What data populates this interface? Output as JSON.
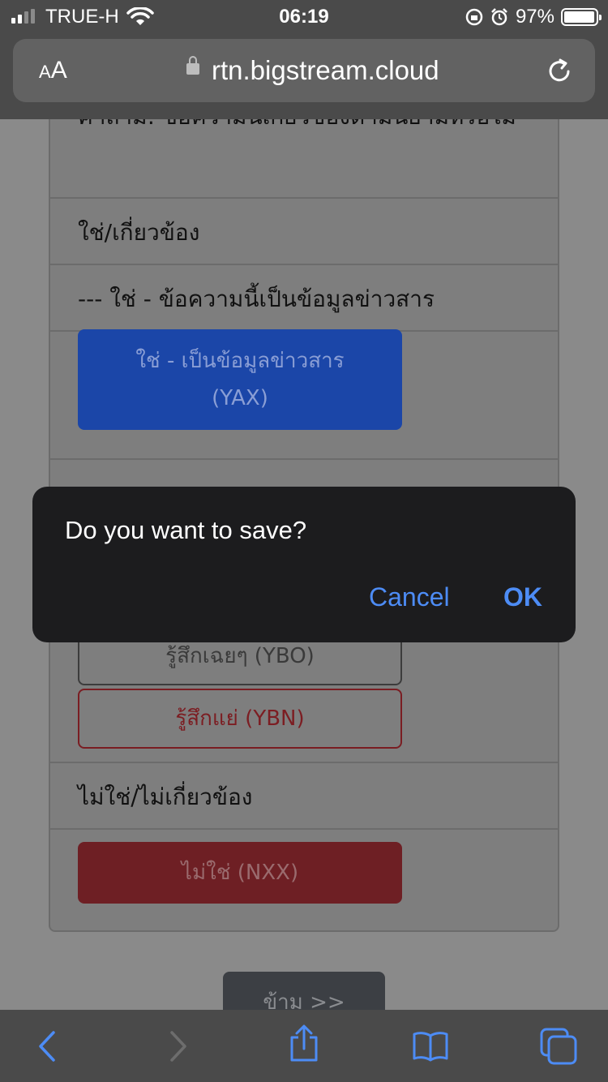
{
  "status_bar": {
    "carrier": "TRUE-H",
    "time": "06:19",
    "battery_percent": "97%",
    "battery_level": 0.97
  },
  "browser": {
    "text_size_label": {
      "small": "A",
      "large": "A"
    },
    "url": "rtn.bigstream.cloud"
  },
  "page": {
    "question_text": "คำถาม: ข้อความนี้เกี่ยวข้องตามนิยามหรือไม่",
    "relevant_label": "ใช่/เกี่ยวข้อง",
    "info_heading": "--- ใช่ - ข้อความนี้เป็นข้อมูลข่าวสาร",
    "btn_yax_line1": "ใช่ - เป็นข้อมูลข่าวสาร",
    "btn_yax_line2": "(YAX)",
    "btn_ybo": "รู้สึกเฉยๆ (YBO)",
    "btn_ybn": "รู้สึกแย่ (YBN)",
    "not_relevant_label": "ไม่ใช่/ไม่เกี่ยวข้อง",
    "btn_nxx": "ไม่ใช่ (NXX)",
    "skip_button": "ข้าม >>"
  },
  "dialog": {
    "message": "Do you want to save?",
    "cancel": "Cancel",
    "ok": "OK"
  },
  "colors": {
    "accent_blue": "#1b46a8",
    "danger": "#6e1f24",
    "dialog_button": "#4d8cf5"
  }
}
